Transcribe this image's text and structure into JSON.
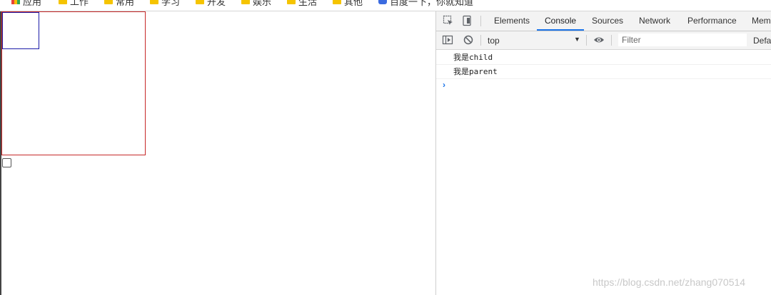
{
  "bookmarks": [
    {
      "label": "应用",
      "icon": "apps-icon"
    },
    {
      "label": "工作",
      "icon": "folder-icon"
    },
    {
      "label": "常用",
      "icon": "folder-icon"
    },
    {
      "label": "学习",
      "icon": "folder-icon"
    },
    {
      "label": "开发",
      "icon": "folder-icon"
    },
    {
      "label": "娱乐",
      "icon": "folder-icon"
    },
    {
      "label": "生活",
      "icon": "folder-icon"
    },
    {
      "label": "其他",
      "icon": "folder-icon"
    },
    {
      "label": "百度一下，你就知道",
      "icon": "baidu-icon"
    }
  ],
  "devtools": {
    "tabs": [
      "Elements",
      "Console",
      "Sources",
      "Network",
      "Performance",
      "Mem"
    ],
    "active_tab": "Console",
    "accent_color": "#1a73e8"
  },
  "console": {
    "context": "top",
    "filter_placeholder": "Filter",
    "levels": "Defa",
    "logs": [
      "我是child",
      "我是parent"
    ],
    "prompt": "›"
  },
  "page": {
    "parent_border_color": "#c62828",
    "child_border_color": "#1a1aa8"
  },
  "watermark": "https://blog.csdn.net/zhang070514"
}
